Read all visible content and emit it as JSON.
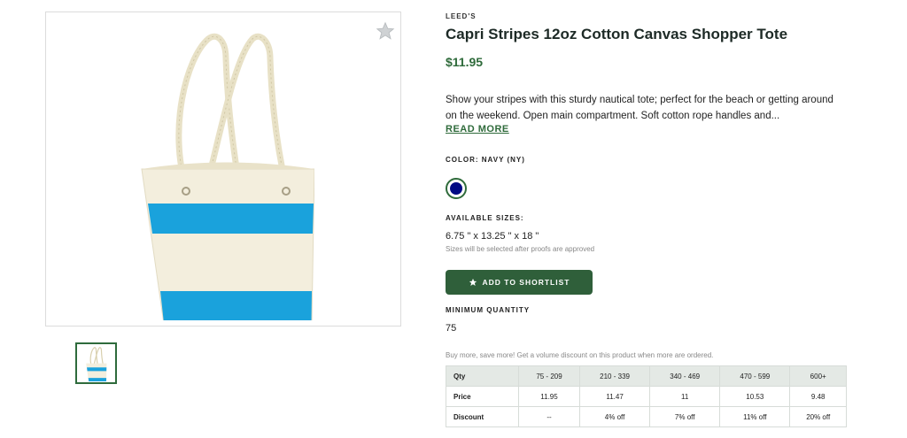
{
  "product": {
    "brand": "LEED'S",
    "title": "Capri Stripes 12oz Cotton Canvas Shopper Tote",
    "price": "$11.95",
    "description": "Show your stripes with this sturdy nautical tote; perfect for the beach or getting around on the weekend. Open main compartment. Soft cotton rope handles and...",
    "read_more": "READ MORE",
    "color_label": "COLOR: NAVY (NY)",
    "color_swatch": "#000a84",
    "sizes_label": "AVAILABLE SIZES:",
    "size_value": "6.75 \" x 13.25 \" x 18 \"",
    "size_note": "Sizes will be selected after proofs are approved",
    "shortlist_button": "ADD TO SHORTLIST",
    "min_qty_label": "MINIMUM QUANTITY",
    "min_qty_value": "75",
    "discount_note": "Buy more, save more! Get a volume discount on this product when more are ordered."
  },
  "colors": {
    "accent": "#2f6b3b",
    "button": "#2f5f3a",
    "stripe": "#1aa2dc",
    "canvas": "#f3eedd"
  },
  "icons": {
    "favorite": "star-icon",
    "shortlist": "star-icon"
  },
  "pricing": {
    "headers": [
      "Qty",
      "75 - 209",
      "210 - 339",
      "340 - 469",
      "470 - 599",
      "600+"
    ],
    "price_row": [
      "Price",
      "11.95",
      "11.47",
      "11",
      "10.53",
      "9.48"
    ],
    "discount_row": [
      "Discount",
      "--",
      "4% off",
      "7% off",
      "11% off",
      "20% off"
    ]
  }
}
